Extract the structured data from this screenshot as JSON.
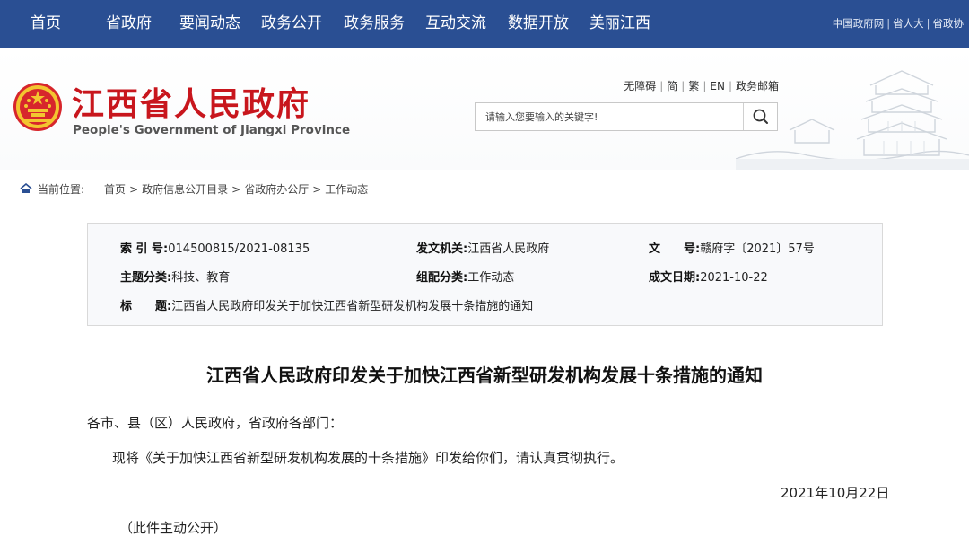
{
  "nav": {
    "items": [
      "首页",
      "省政府",
      "要闻动态",
      "政务公开",
      "政务服务",
      "互动交流",
      "数据开放",
      "美丽江西"
    ],
    "external": [
      "中国政府网",
      "省人大",
      "省政协"
    ]
  },
  "header": {
    "title": "江西省人民政府",
    "subtitle": "People's Government of Jiangxi Province",
    "util_links": [
      "无障碍",
      "简",
      "繁",
      "EN",
      "政务邮箱"
    ],
    "search_placeholder": "请输入您要输入的关键字!"
  },
  "breadcrumb": {
    "label": "当前位置:",
    "items": [
      "首页",
      "政府信息公开目录",
      "省政府办公厅",
      "工作动态"
    ]
  },
  "meta": {
    "index_label": "索 引 号:",
    "index_value": "014500815/2021-08135",
    "issuer_label": "发文机关:",
    "issuer_value": "江西省人民政府",
    "docno_label": "文　　号:",
    "docno_value": "赣府字〔2021〕57号",
    "topic_label": "主题分类:",
    "topic_value": "科技、教育",
    "group_label": "组配分类:",
    "group_value": "工作动态",
    "date_label": "成文日期:",
    "date_value": "2021-10-22",
    "title_label": "标　　题:",
    "title_value": "江西省人民政府印发关于加快江西省新型研发机构发展十条措施的通知"
  },
  "article": {
    "title": "江西省人民政府印发关于加快江西省新型研发机构发展十条措施的通知",
    "salutation": "各市、县（区）人民政府，省政府各部门：",
    "body": "现将《关于加快江西省新型研发机构发展的十条措施》印发给你们，请认真贯彻执行。",
    "date": "2021年10月22日",
    "note": "（此件主动公开）"
  },
  "colors": {
    "nav_bg": "#2a4f93",
    "title_red": "#c8161d"
  }
}
